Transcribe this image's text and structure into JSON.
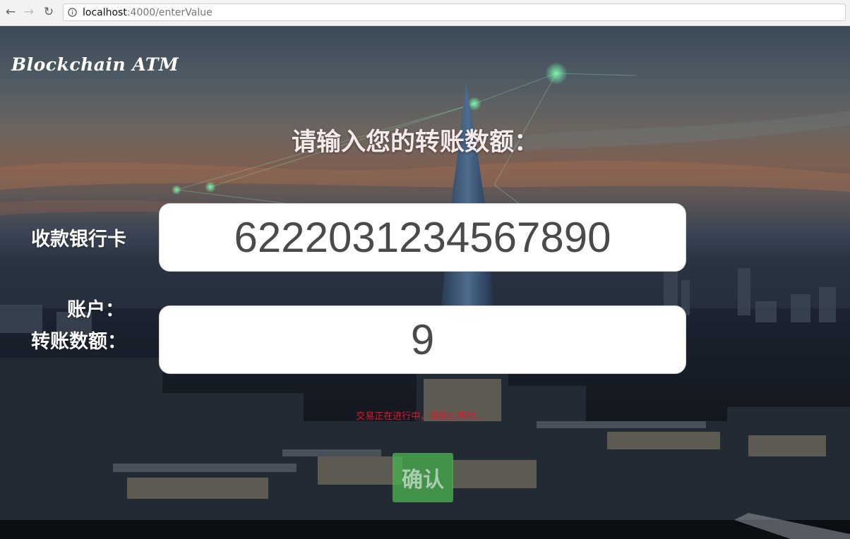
{
  "browser": {
    "url_host": "localhost",
    "url_path": ":4000/enterValue"
  },
  "brand": "Blockchain ATM",
  "heading": "请输入您的转账数额：",
  "form": {
    "card_label": "收款银行卡",
    "card_value": "6222031234567890",
    "account_label": "账户：",
    "amount_label": "转账数额：",
    "amount_value": "9"
  },
  "status_text": "交易正在进行中，请耐心等待...",
  "confirm_label": "确认",
  "colors": {
    "status_text": "#e0192a",
    "confirm_button": "#4caf50"
  }
}
